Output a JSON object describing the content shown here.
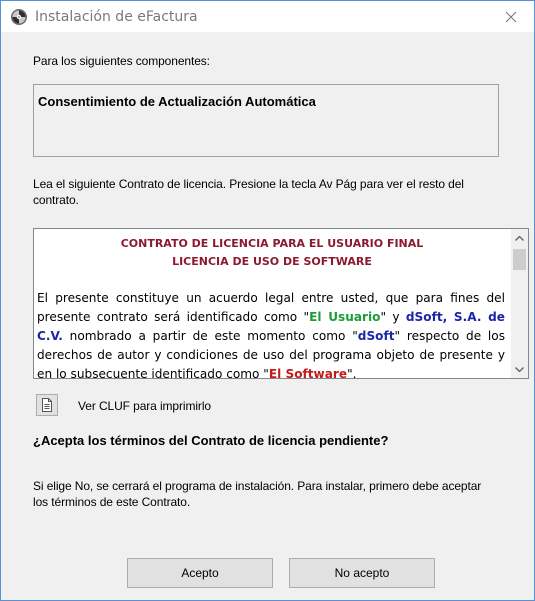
{
  "window": {
    "title": "Instalación de eFactura",
    "icons": {
      "app": "installer-cd-icon",
      "close": "close-icon"
    }
  },
  "components": {
    "label": "Para los siguientes componentes:",
    "item": "Consentimiento de Actualización Automática"
  },
  "instructions": {
    "line1": "Lea el siguiente Contrato de licencia. Presione la tecla Av Pág para ver el resto del",
    "line2": "contrato."
  },
  "license": {
    "heading1": "CONTRATO DE LICENCIA PARA EL USUARIO FINAL",
    "heading2": "LICENCIA DE USO DE SOFTWARE",
    "p_text1": "El presente constituye un acuerdo legal entre usted, que para fines del presente contrato será identificado como \"",
    "p_user": "El Usuario",
    "p_text2": "\" y ",
    "p_company": "dSoft, S.A. de C.V.",
    "p_text3": " nombrado a partir de este momento como \"",
    "p_dsoft": "dSoft",
    "p_text4": "\" respecto de los derechos de autor y condiciones de uso del programa objeto de presente y en lo subsecuente identificado como \"",
    "p_software": "El Software",
    "p_text5": "\".",
    "colors": {
      "heading": "#8b1a2e",
      "user": "#1d9c3b",
      "company": "#1b27a6",
      "software": "#c31a1a"
    }
  },
  "print": {
    "label": "Ver CLUF para imprimirlo",
    "icon": "document-print-icon"
  },
  "question": "¿Acepta los términos del Contrato de licencia pendiente?",
  "note": {
    "line1": "Si elige No, se cerrará el programa de instalación. Para instalar, primero debe aceptar",
    "line2": "los términos de este Contrato."
  },
  "buttons": {
    "accept": "Acepto",
    "decline": "No acepto"
  }
}
